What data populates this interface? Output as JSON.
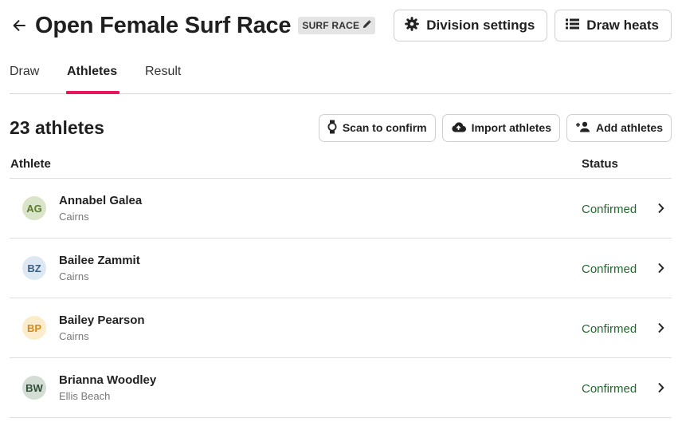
{
  "header": {
    "title": "Open Female Surf Race",
    "type_badge": "SURF RACE",
    "actions": [
      {
        "label": "Division settings",
        "icon": "gear-icon"
      },
      {
        "label": "Draw heats",
        "icon": "list-icon"
      }
    ]
  },
  "tabs": [
    {
      "label": "Draw",
      "active": false
    },
    {
      "label": "Athletes",
      "active": true
    },
    {
      "label": "Result",
      "active": false
    }
  ],
  "toolbar": {
    "count_label": "23 athletes",
    "actions": [
      {
        "label": "Scan to confirm",
        "icon": "watch-icon"
      },
      {
        "label": "Import athletes",
        "icon": "cloud-upload-icon"
      },
      {
        "label": "Add athletes",
        "icon": "add-person-icon"
      }
    ]
  },
  "table": {
    "columns": {
      "athlete": "Athlete",
      "status": "Status"
    },
    "rows": [
      {
        "initials": "AG",
        "name": "Annabel Galea",
        "club": "Cairns",
        "status": "Confirmed",
        "avatar_bg": "#d9e4c8",
        "avatar_fg": "#5a7a2a"
      },
      {
        "initials": "BZ",
        "name": "Bailee Zammit",
        "club": "Cairns",
        "status": "Confirmed",
        "avatar_bg": "#dde8f3",
        "avatar_fg": "#3a5f82"
      },
      {
        "initials": "BP",
        "name": "Bailey Pearson",
        "club": "Cairns",
        "status": "Confirmed",
        "avatar_bg": "#fbeccc",
        "avatar_fg": "#d28a1e"
      },
      {
        "initials": "BW",
        "name": "Brianna Woodley",
        "club": "Ellis Beach",
        "status": "Confirmed",
        "avatar_bg": "#d3ddd3",
        "avatar_fg": "#2f4f3a"
      }
    ]
  },
  "colors": {
    "accent": "#e8175d",
    "status_confirmed": "#24692e",
    "border": "#cfcfcf"
  }
}
